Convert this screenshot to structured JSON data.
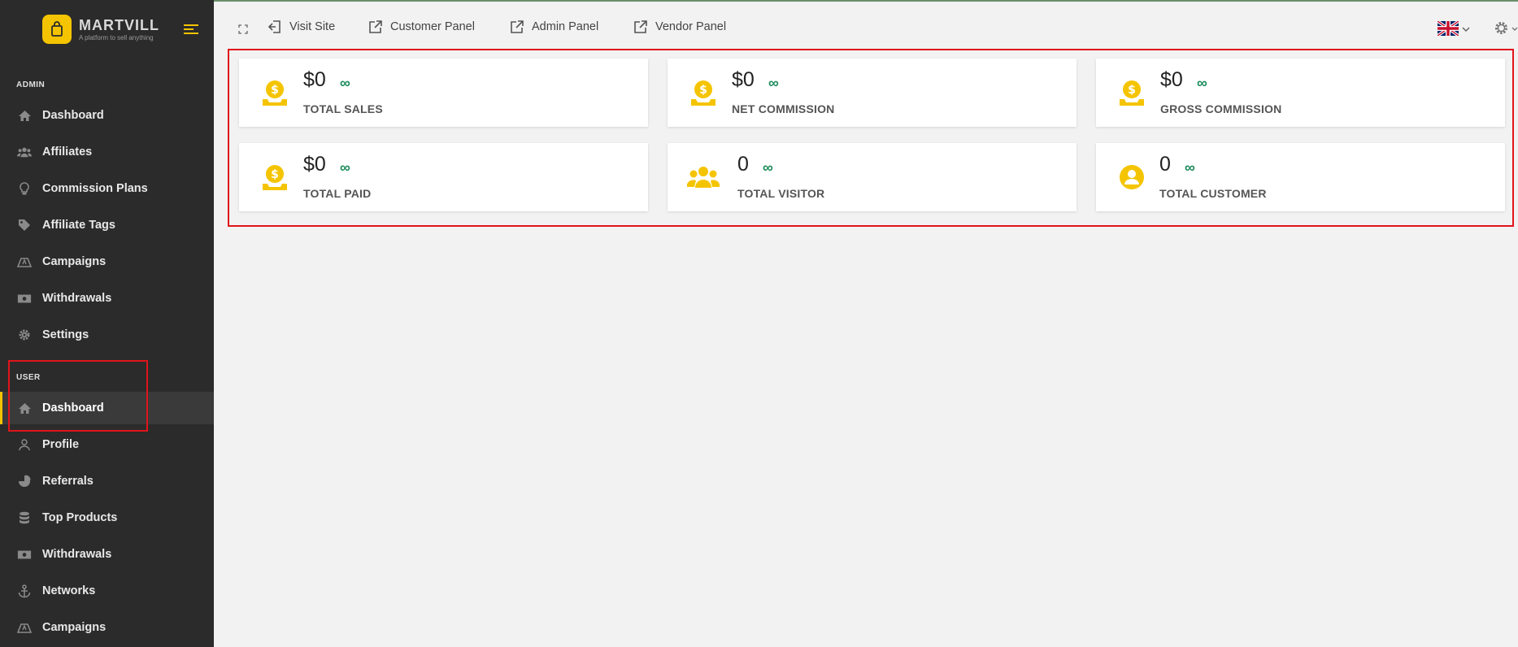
{
  "brand": {
    "name": "MARTVILL",
    "tagline": "A platform to sell anything"
  },
  "sidebar": {
    "admin_label": "ADMIN",
    "admin_items": [
      {
        "label": "Dashboard",
        "icon": "home-icon"
      },
      {
        "label": "Affiliates",
        "icon": "users-icon"
      },
      {
        "label": "Commission Plans",
        "icon": "lightbulb-icon"
      },
      {
        "label": "Affiliate Tags",
        "icon": "tag-icon"
      },
      {
        "label": "Campaigns",
        "icon": "campaign-icon"
      },
      {
        "label": "Withdrawals",
        "icon": "money-icon"
      },
      {
        "label": "Settings",
        "icon": "gear-icon"
      }
    ],
    "user_label": "USER",
    "user_items": [
      {
        "label": "Dashboard",
        "icon": "home-icon",
        "active": true
      },
      {
        "label": "Profile",
        "icon": "user-icon"
      },
      {
        "label": "Referrals",
        "icon": "chart-pie-icon"
      },
      {
        "label": "Top Products",
        "icon": "database-icon"
      },
      {
        "label": "Withdrawals",
        "icon": "money-icon"
      },
      {
        "label": "Networks",
        "icon": "anchor-icon"
      },
      {
        "label": "Campaigns",
        "icon": "campaign-icon"
      }
    ]
  },
  "topbar": {
    "visit_site": "Visit Site",
    "customer_panel": "Customer Panel",
    "admin_panel": "Admin Panel",
    "vendor_panel": "Vendor Panel"
  },
  "cards": [
    {
      "value": "$0",
      "trend": "∞",
      "label": "TOTAL SALES",
      "icon": "coin-hand-icon"
    },
    {
      "value": "$0",
      "trend": "∞",
      "label": "NET COMMISSION",
      "icon": "coin-hand-icon"
    },
    {
      "value": "$0",
      "trend": "∞",
      "label": "GROSS COMMISSION",
      "icon": "coin-hand-icon"
    },
    {
      "value": "$0",
      "trend": "∞",
      "label": "TOTAL PAID",
      "icon": "coin-hand-icon"
    },
    {
      "value": "0",
      "trend": "∞",
      "label": "TOTAL VISITOR",
      "icon": "users-icon"
    },
    {
      "value": "0",
      "trend": "∞",
      "label": "TOTAL CUSTOMER",
      "icon": "user-circle-icon"
    }
  ],
  "colors": {
    "accent": "#f5c400",
    "sidebar_bg": "#2b2b2b",
    "trend": "#1a8a5a",
    "highlight": "#e0141b"
  }
}
